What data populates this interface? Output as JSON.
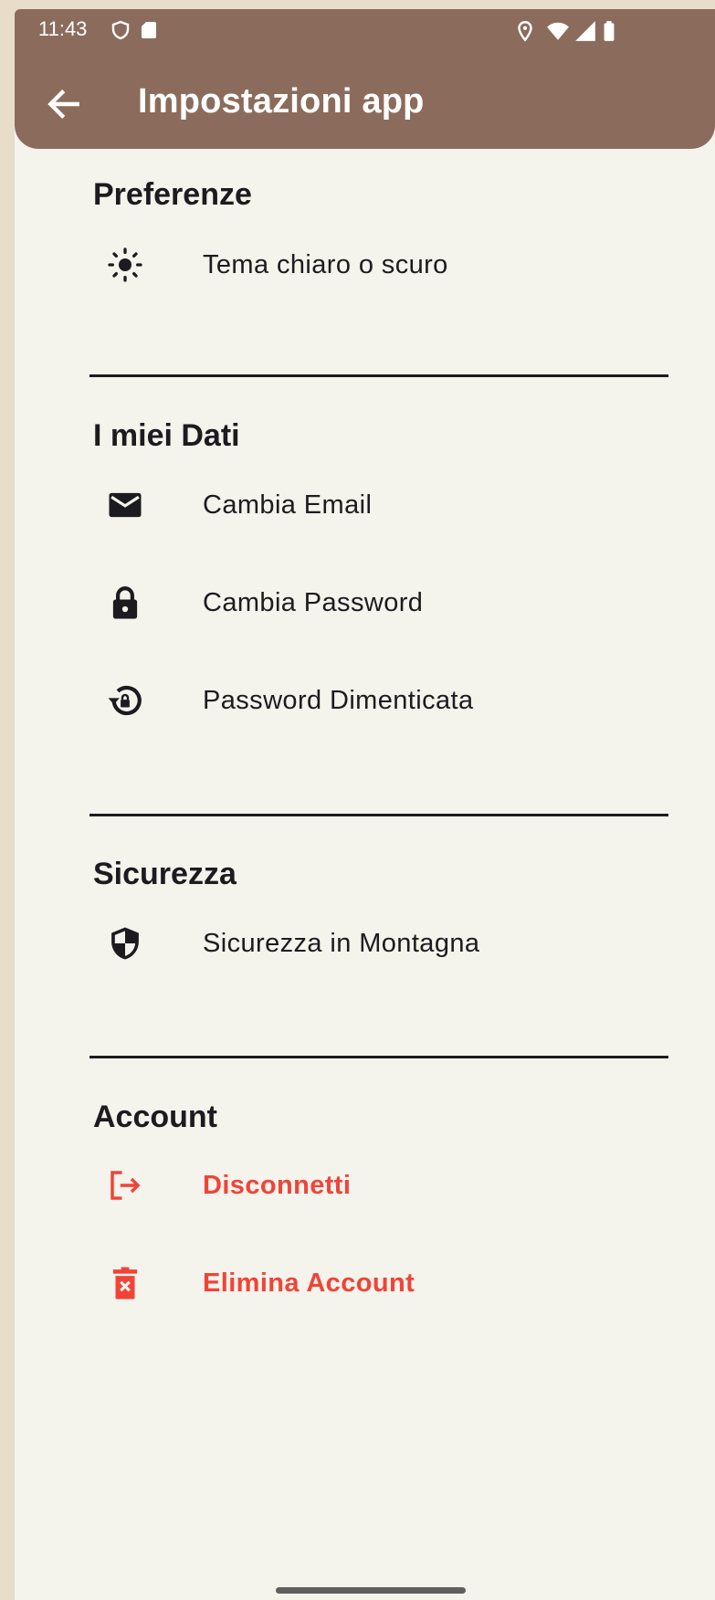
{
  "status_bar": {
    "time": "11:43",
    "left_icons": [
      "shield-icon",
      "sd-card-icon"
    ],
    "right_icons": [
      "location-icon",
      "wifi-icon",
      "signal-icon",
      "battery-icon"
    ]
  },
  "app_bar": {
    "back_icon": "arrow-back-icon",
    "title": "Impostazioni app",
    "color": "#8b6c5c"
  },
  "sections": [
    {
      "title": "Preferenze",
      "items": [
        {
          "label": "Tema chiaro o scuro",
          "icon": "sun-icon"
        }
      ]
    },
    {
      "title": "I miei Dati",
      "items": [
        {
          "label": "Cambia Email",
          "icon": "email-icon"
        },
        {
          "label": "Cambia Password",
          "icon": "lock-icon"
        },
        {
          "label": "Password Dimenticata",
          "icon": "lock-reset-icon"
        }
      ]
    },
    {
      "title": "Sicurezza",
      "items": [
        {
          "label": "Sicurezza in Montagna",
          "icon": "security-shield-icon"
        }
      ]
    },
    {
      "title": "Account",
      "items": [
        {
          "label": "Disconnetti",
          "icon": "logout-icon",
          "danger": true
        },
        {
          "label": "Elimina Account",
          "icon": "delete-icon",
          "danger": true
        }
      ]
    }
  ],
  "colors": {
    "background": "#f4f3ec",
    "danger": "#f04438",
    "text": "#1c1b1f"
  }
}
